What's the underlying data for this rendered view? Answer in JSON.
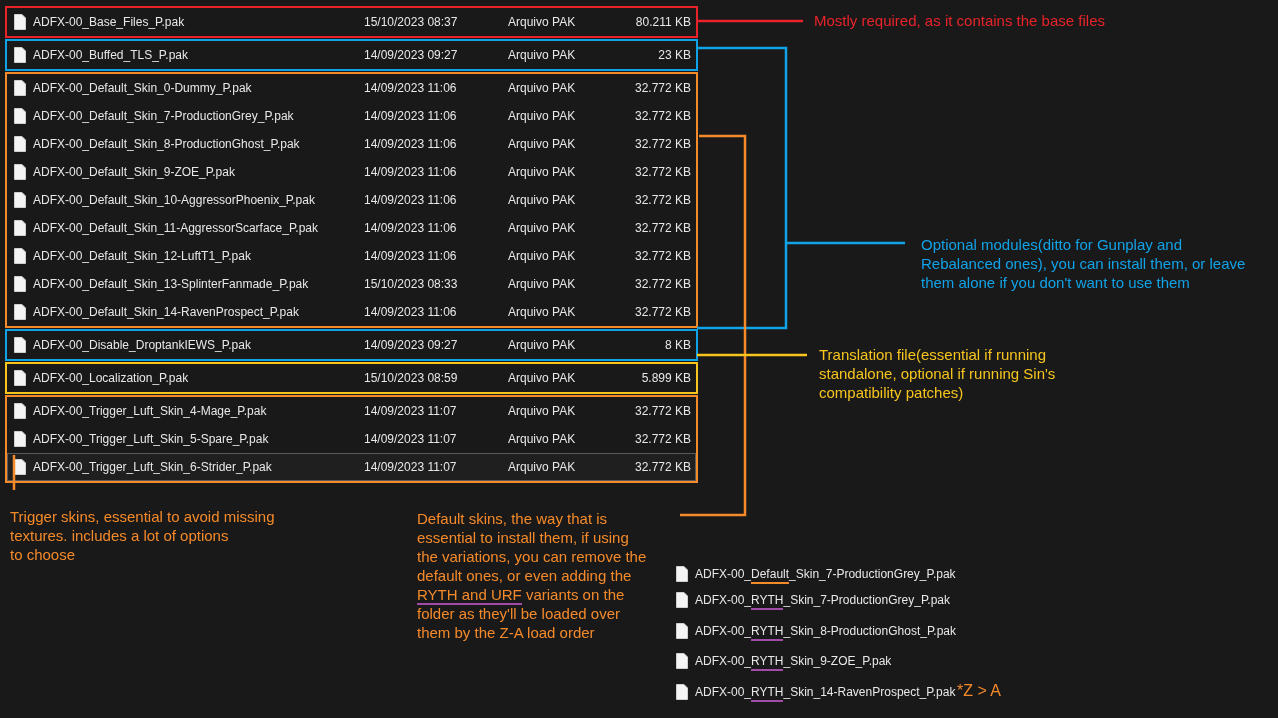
{
  "file_groups": [
    {
      "color": "#e8232a",
      "files": [
        {
          "name": "ADFX-00_Base_Files_P.pak",
          "date": "15/10/2023 08:37",
          "type": "Arquivo PAK",
          "size": "80.211 KB",
          "selected": false
        }
      ]
    },
    {
      "color": "#11a3e8",
      "files": [
        {
          "name": "ADFX-00_Buffed_TLS_P.pak",
          "date": "14/09/2023 09:27",
          "type": "Arquivo PAK",
          "size": "23 KB",
          "selected": false
        }
      ]
    },
    {
      "color": "#f58a2a",
      "files": [
        {
          "name": "ADFX-00_Default_Skin_0-Dummy_P.pak",
          "date": "14/09/2023 11:06",
          "type": "Arquivo PAK",
          "size": "32.772 KB",
          "selected": false
        },
        {
          "name": "ADFX-00_Default_Skin_7-ProductionGrey_P.pak",
          "date": "14/09/2023 11:06",
          "type": "Arquivo PAK",
          "size": "32.772 KB",
          "selected": false
        },
        {
          "name": "ADFX-00_Default_Skin_8-ProductionGhost_P.pak",
          "date": "14/09/2023 11:06",
          "type": "Arquivo PAK",
          "size": "32.772 KB",
          "selected": false
        },
        {
          "name": "ADFX-00_Default_Skin_9-ZOE_P.pak",
          "date": "14/09/2023 11:06",
          "type": "Arquivo PAK",
          "size": "32.772 KB",
          "selected": false
        },
        {
          "name": "ADFX-00_Default_Skin_10-AggressorPhoenix_P.pak",
          "date": "14/09/2023 11:06",
          "type": "Arquivo PAK",
          "size": "32.772 KB",
          "selected": false
        },
        {
          "name": "ADFX-00_Default_Skin_11-AggressorScarface_P.pak",
          "date": "14/09/2023 11:06",
          "type": "Arquivo PAK",
          "size": "32.772 KB",
          "selected": false
        },
        {
          "name": "ADFX-00_Default_Skin_12-LuftT1_P.pak",
          "date": "14/09/2023 11:06",
          "type": "Arquivo PAK",
          "size": "32.772 KB",
          "selected": false
        },
        {
          "name": "ADFX-00_Default_Skin_13-SplinterFanmade_P.pak",
          "date": "15/10/2023 08:33",
          "type": "Arquivo PAK",
          "size": "32.772 KB",
          "selected": false
        },
        {
          "name": "ADFX-00_Default_Skin_14-RavenProspect_P.pak",
          "date": "14/09/2023 11:06",
          "type": "Arquivo PAK",
          "size": "32.772 KB",
          "selected": false
        }
      ]
    },
    {
      "color": "#11a3e8",
      "files": [
        {
          "name": "ADFX-00_Disable_DroptankIEWS_P.pak",
          "date": "14/09/2023 09:27",
          "type": "Arquivo PAK",
          "size": "8 KB",
          "selected": false
        }
      ]
    },
    {
      "color": "#f7c51e",
      "files": [
        {
          "name": "ADFX-00_Localization_P.pak",
          "date": "15/10/2023 08:59",
          "type": "Arquivo PAK",
          "size": "5.899 KB",
          "selected": false
        }
      ]
    },
    {
      "color": "#f58a2a",
      "files": [
        {
          "name": "ADFX-00_Trigger_Luft_Skin_4-Mage_P.pak",
          "date": "14/09/2023 11:07",
          "type": "Arquivo PAK",
          "size": "32.772 KB",
          "selected": false
        },
        {
          "name": "ADFX-00_Trigger_Luft_Skin_5-Spare_P.pak",
          "date": "14/09/2023 11:07",
          "type": "Arquivo PAK",
          "size": "32.772 KB",
          "selected": false
        },
        {
          "name": "ADFX-00_Trigger_Luft_Skin_6-Strider_P.pak",
          "date": "14/09/2023 11:07",
          "type": "Arquivo PAK",
          "size": "32.772 KB",
          "selected": true
        }
      ]
    }
  ],
  "notes": [
    {
      "color": "#e8232a",
      "lines": [
        "Mostly required, as it contains the base files"
      ]
    },
    {
      "color": "#11a3e8",
      "lines": [
        "Optional modules(ditto for Gunplay and",
        "Rebalanced ones), you can install them, or leave",
        "them alone if you don't want to use them"
      ]
    },
    {
      "color": "#f7c51e",
      "lines": [
        "Translation file(essential if running",
        "standalone, optional if running Sin's",
        "compatibility patches)"
      ]
    },
    {
      "color": "#f58a2a",
      "lines": [
        "Trigger skins, essential to avoid missing",
        "textures. includes a lot of options",
        "to choose"
      ]
    },
    {
      "color": "#f58a2a",
      "lines": [
        "Default skins, the way that is",
        "essential to install them, if using",
        "the variations, you can remove the",
        "default ones, or even adding the",
        {
          "underlined": "RYTH and URF",
          "color": "#a04ca8",
          "rest": " variants on the"
        },
        "folder as they'll be loaded over",
        "them by the Z-A load order"
      ]
    }
  ],
  "example_files": [
    {
      "prefix": "ADFX-00_",
      "marked": "Default",
      "suffix": "_Skin_7-ProductionGrey_P.pak",
      "color": "#f58a2a"
    },
    {
      "prefix": "ADFX-00_",
      "marked": "RYTH",
      "suffix": "_Skin_7-ProductionGrey_P.pak",
      "color": "#a04ca8"
    },
    {
      "prefix": "ADFX-00_",
      "marked": "RYTH",
      "suffix": "_Skin_8-ProductionGhost_P.pak",
      "color": "#a04ca8"
    },
    {
      "prefix": "ADFX-00_",
      "marked": "RYTH",
      "suffix": "_Skin_9-ZOE_P.pak",
      "color": "#a04ca8"
    },
    {
      "prefix": "ADFX-00_",
      "marked": "RYTH",
      "suffix": "_Skin_14-RavenProspect_P.pak",
      "color": "#a04ca8"
    }
  ],
  "order_note": {
    "text": "*Z > A",
    "color": "#f58a2a"
  }
}
